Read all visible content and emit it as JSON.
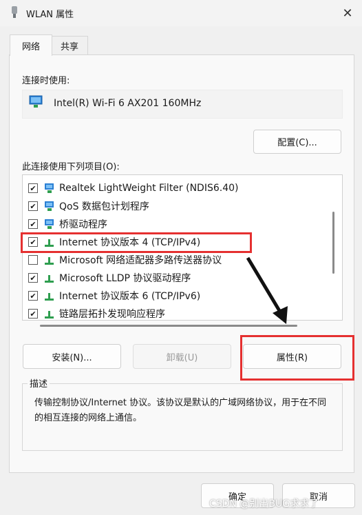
{
  "window": {
    "title": "WLAN 属性",
    "close_glyph": "✕"
  },
  "tabs": [
    {
      "label": "网络"
    },
    {
      "label": "共享"
    }
  ],
  "connect_using": {
    "label": "连接时使用:",
    "adapter": "Intel(R) Wi-Fi 6 AX201 160MHz",
    "configure_button": "配置(C)..."
  },
  "items_section": {
    "label": "此连接使用下列项目(O):",
    "items": [
      {
        "label": "Realtek LightWeight Filter (NDIS6.40)",
        "checked": true,
        "icon": "network-filter-icon"
      },
      {
        "label": "QoS 数据包计划程序",
        "checked": true,
        "icon": "network-filter-icon"
      },
      {
        "label": "桥驱动程序",
        "checked": true,
        "icon": "network-filter-icon"
      },
      {
        "label": "Internet 协议版本 4 (TCP/IPv4)",
        "checked": true,
        "icon": "protocol-icon"
      },
      {
        "label": "Microsoft 网络适配器多路传送器协议",
        "checked": false,
        "icon": "protocol-icon"
      },
      {
        "label": "Microsoft LLDP 协议驱动程序",
        "checked": true,
        "icon": "protocol-icon"
      },
      {
        "label": "Internet 协议版本 6 (TCP/IPv6)",
        "checked": true,
        "icon": "protocol-icon"
      },
      {
        "label": "链路层拓扑发现响应程序",
        "checked": true,
        "icon": "protocol-icon"
      }
    ],
    "check_glyph": "✔"
  },
  "buttons": {
    "install": "安装(N)...",
    "uninstall": "卸载(U)",
    "properties": "属性(R)",
    "ok": "确定",
    "cancel": "取消"
  },
  "description": {
    "legend": "描述",
    "text": "传输控制协议/Internet 协议。该协议是默认的广域网络协议，用于在不同的相互连接的网络上通信。"
  },
  "watermark": "CSDN @别出BUG求求了",
  "colors": {
    "highlight": "#e53030",
    "protocol_green": "#2e9e4f",
    "adapter_blue": "#2a7fd4"
  }
}
